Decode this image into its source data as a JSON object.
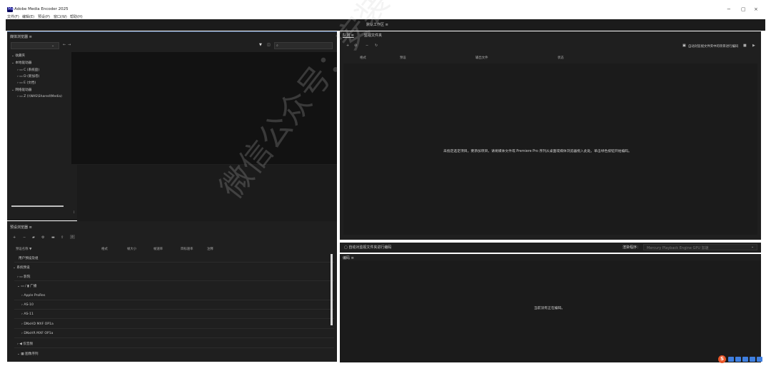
{
  "window": {
    "title": "Adobe Media Encoder 2025",
    "logo_text": "Me",
    "controls": [
      "−",
      "▢",
      "×"
    ]
  },
  "menu": [
    "文件(F)",
    "编辑(E)",
    "预设(P)",
    "窗口(W)",
    "帮助(H)"
  ],
  "workspace": {
    "label": "默认工作区 ≡"
  },
  "media_browser": {
    "title": "媒体浏览器 ≡",
    "search_placeholder": "",
    "tree": [
      "收藏夹",
      "本地驱动器",
      "C (系统盘)",
      "D (新加卷)",
      "E (文档)",
      "网络驱动器",
      "Z (\\\\NAS\\Shared\\Media)"
    ]
  },
  "preset_browser": {
    "title": "预设浏览器 ≡",
    "columns": [
      "预设名称 ▼",
      "格式",
      "帧大小",
      "帧速率",
      "目标速率",
      "注释"
    ],
    "rows": [
      "用户预设及组",
      "系统预设",
      "影院",
      "广播",
      "Apple ProRes",
      "AS-10",
      "AS-11",
      "DNxHD MXF OP1a",
      "DNxHR MXF OP1a",
      "仅音频",
      "图像序列"
    ]
  },
  "queue": {
    "tabs": [
      "队列 ≡",
      "监视文件夹"
    ],
    "auto_start": "自动对监视文件夹中的项目进行编码",
    "columns": [
      "格式",
      "预设",
      "输出文件",
      "状态"
    ],
    "message": "未指定选定项目。要添加项目，请将媒体文件或 Premiere Pro 序列从桌面或媒体浏览器拖入此处。单击绿色按钮开始编码。",
    "renderer_label": "渲染程序：",
    "renderer_value": "Mercury Playback Engine GPU 加速",
    "auto_encode_label": "自动对监视文件夹进行编码"
  },
  "encoding": {
    "title": "编码 ≡",
    "message": "当前没有正在编码。"
  },
  "watermark": "微信公众号：安装软件指南"
}
